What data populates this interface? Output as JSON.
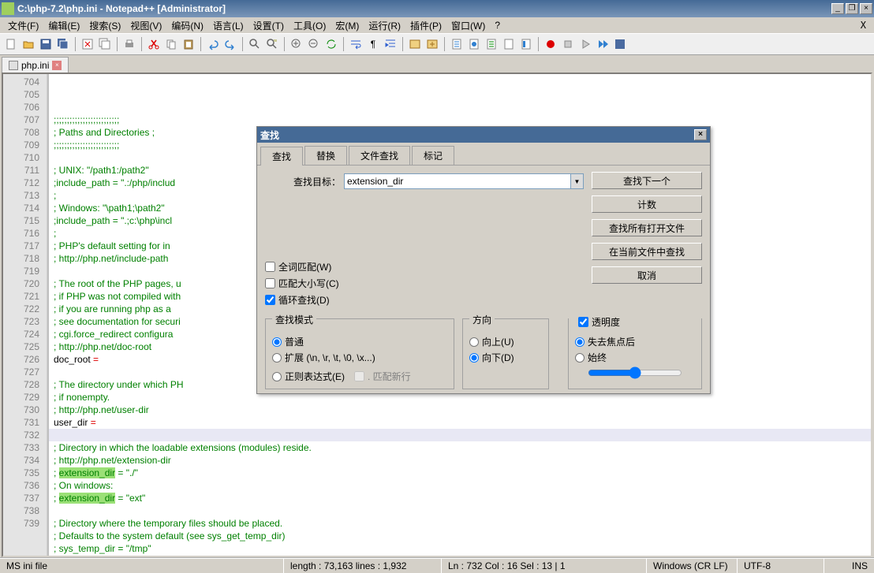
{
  "window": {
    "title": "C:\\php-7.2\\php.ini - Notepad++ [Administrator]",
    "min": "_",
    "max": "▢",
    "restore": "❐",
    "close": "×"
  },
  "menu": [
    "文件(F)",
    "编辑(E)",
    "搜索(S)",
    "视图(V)",
    "编码(N)",
    "语言(L)",
    "设置(T)",
    "工具(O)",
    "宏(M)",
    "运行(R)",
    "插件(P)",
    "窗口(W)",
    "?"
  ],
  "tab": {
    "name": "php.ini"
  },
  "gutter_start": 704,
  "lines": [
    {
      "t": ";;;;;;;;;;;;;;;;;;;;;;;;;",
      "cls": "c-comment"
    },
    {
      "t": "; Paths and Directories ;",
      "cls": "c-comment"
    },
    {
      "t": ";;;;;;;;;;;;;;;;;;;;;;;;;",
      "cls": "c-comment"
    },
    {
      "t": "",
      "cls": ""
    },
    {
      "t": "; UNIX: \"/path1:/path2\"",
      "cls": "c-comment"
    },
    {
      "t": ";include_path = \".:/php/includ",
      "cls": "c-comment"
    },
    {
      "t": ";",
      "cls": "c-comment"
    },
    {
      "t": "; Windows: \"\\path1;\\path2\"",
      "cls": "c-comment"
    },
    {
      "t": ";include_path = \".;c:\\php\\incl",
      "cls": "c-comment"
    },
    {
      "t": ";",
      "cls": "c-comment"
    },
    {
      "t": "; PHP's default setting for in",
      "cls": "c-comment"
    },
    {
      "t": "; http://php.net/include-path",
      "cls": "c-comment"
    },
    {
      "t": "",
      "cls": ""
    },
    {
      "t": "; The root of the PHP pages, u",
      "cls": "c-comment"
    },
    {
      "t": "; if PHP was not compiled with",
      "cls": "c-comment"
    },
    {
      "t": "; if you are running php as a ",
      "cls": "c-comment"
    },
    {
      "t": "; see documentation for securi",
      "cls": "c-comment"
    },
    {
      "t": "; cgi.force_redirect configura",
      "cls": "c-comment"
    },
    {
      "t": "; http://php.net/doc-root",
      "cls": "c-comment"
    },
    {
      "pre": "doc_root",
      "mid": " =",
      "post": "",
      "cls": "c-black",
      "midcls": "c-red"
    },
    {
      "t": "",
      "cls": ""
    },
    {
      "t": "; The directory under which PH",
      "cls": "c-comment"
    },
    {
      "t": "; if nonempty.",
      "cls": "c-comment"
    },
    {
      "t": "; http://php.net/user-dir",
      "cls": "c-comment"
    },
    {
      "pre": "user_dir",
      "mid": " =",
      "post": "",
      "cls": "c-black",
      "midcls": "c-red"
    },
    {
      "t": "",
      "cls": ""
    },
    {
      "t": "; Directory in which the loadable extensions (modules) reside.",
      "cls": "c-comment"
    },
    {
      "t": "; http://php.net/extension-dir",
      "cls": "c-comment"
    },
    {
      "pre": "; ",
      "hl": "extension_dir",
      "midseg": " = ",
      "q": "\"",
      "val": "./",
      "q2": "\""
    },
    {
      "t": "; On windows:",
      "cls": "c-comment"
    },
    {
      "pre": "; ",
      "hl": "extension_dir",
      "midseg": " = ",
      "q": "\"",
      "val": "ext",
      "q2": "\""
    },
    {
      "t": "",
      "cls": ""
    },
    {
      "t": "; Directory where the temporary files should be placed.",
      "cls": "c-comment"
    },
    {
      "t": "; Defaults to the system default (see sys_get_temp_dir)",
      "cls": "c-comment"
    },
    {
      "t": "; sys_temp_dir = \"/tmp\"",
      "cls": "c-comment"
    },
    {
      "t": "",
      "cls": ""
    }
  ],
  "status": {
    "lang": "MS ini file",
    "length": "length : 73,163    lines : 1,932",
    "pos": "Ln :  732    Col :  16    Sel :  13 | 1",
    "eol": "Windows (CR LF)",
    "enc": "UTF-8",
    "ins": "INS"
  },
  "dialog": {
    "title": "查找",
    "tabs": [
      "查找",
      "替换",
      "文件查找",
      "标记"
    ],
    "target_lbl": "查找目标：",
    "target_val": "extension_dir",
    "btn_next": "查找下一个",
    "btn_count": "计数",
    "btn_all": "查找所有打开文件",
    "btn_cur": "在当前文件中查找",
    "btn_cancel": "取消",
    "chk_whole": "全词匹配(W)",
    "chk_case": "匹配大小写(C)",
    "chk_wrap": "循环查找(D)",
    "grp_mode": "查找模式",
    "rd_normal": "普通",
    "rd_ext": "扩展 (\\n, \\r, \\t, \\0, \\x...)",
    "rd_regex": "正则表达式(E)",
    "chk_nl": ". 匹配新行",
    "grp_dir": "方向",
    "rd_up": "向上(U)",
    "rd_down": "向下(D)",
    "chk_trans": "透明度",
    "rd_focus": "失去焦点后",
    "rd_always": "始终"
  }
}
